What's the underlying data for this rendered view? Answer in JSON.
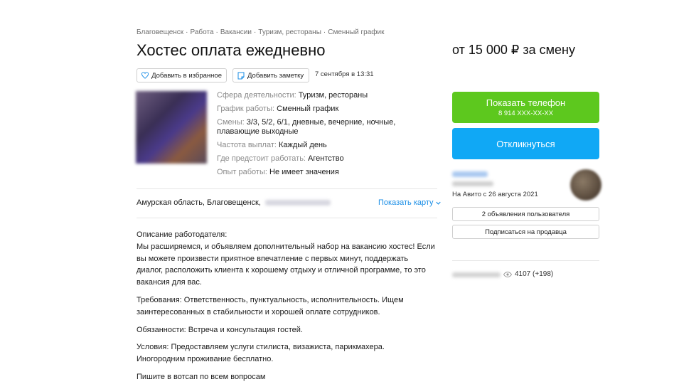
{
  "breadcrumb": [
    "Благовещенск",
    "Работа",
    "Вакансии",
    "Туризм, рестораны",
    "Сменный график"
  ],
  "breadcrumb_sep": "·",
  "title": "Хостес оплата ежедневно",
  "price": "от 15 000 ₽ за смену",
  "actions": {
    "favorite_label": "Добавить в избранное",
    "note_label": "Добавить заметку",
    "date": "7 сентября в 13:31"
  },
  "params": [
    {
      "key": "Сфера деятельности:",
      "value": "Туризм, рестораны"
    },
    {
      "key": "График работы:",
      "value": "Сменный график"
    },
    {
      "key": "Смены:",
      "value": "3/3, 5/2, 6/1, дневные, вечерние, ночные, плавающие выходные"
    },
    {
      "key": "Частота выплат:",
      "value": "Каждый день"
    },
    {
      "key": "Где предстоит работать:",
      "value": "Агентство"
    },
    {
      "key": "Опыт работы:",
      "value": "Не имеет значения"
    }
  ],
  "location": {
    "address": "Амурская область, Благовещенск,",
    "map_link": "Показать карту"
  },
  "description": [
    "Описание работодателя:\nМы расширяемся, и объявляем дополнительный набор на вакансию хостес! Если вы можете произвести приятное впечатление с первых минут, поддержать диалог, расположить клиента к хорошему отдыху и отличной программе, то это вакансия для вас.",
    "Требования: Ответственность, пунктуальность, исполнительность. Ищем заинтересованных в стабильности и хорошей оплате сотрудников.",
    "Обязанности: Встреча и консультация гостей.",
    "Условия: Предоставляем услуги стилиста, визажиста, парикмахера. Иногородним проживание бесплатно.",
    "Пишите в вотсап по всем вопросам"
  ],
  "sidebar": {
    "phone_button": "Показать телефон",
    "phone_masked": "8 914 XXX-XX-XX",
    "respond_button": "Откликнуться",
    "seller_since": "На Авито с 26 августа 2021",
    "seller_ads_button": "2 объявления пользователя",
    "subscribe_button": "Подписаться на продавца",
    "views": "4107 (+198)"
  },
  "colors": {
    "phone_button": "#5dc81e",
    "respond_button": "#10a8f5",
    "link": "#1a8ee6"
  }
}
